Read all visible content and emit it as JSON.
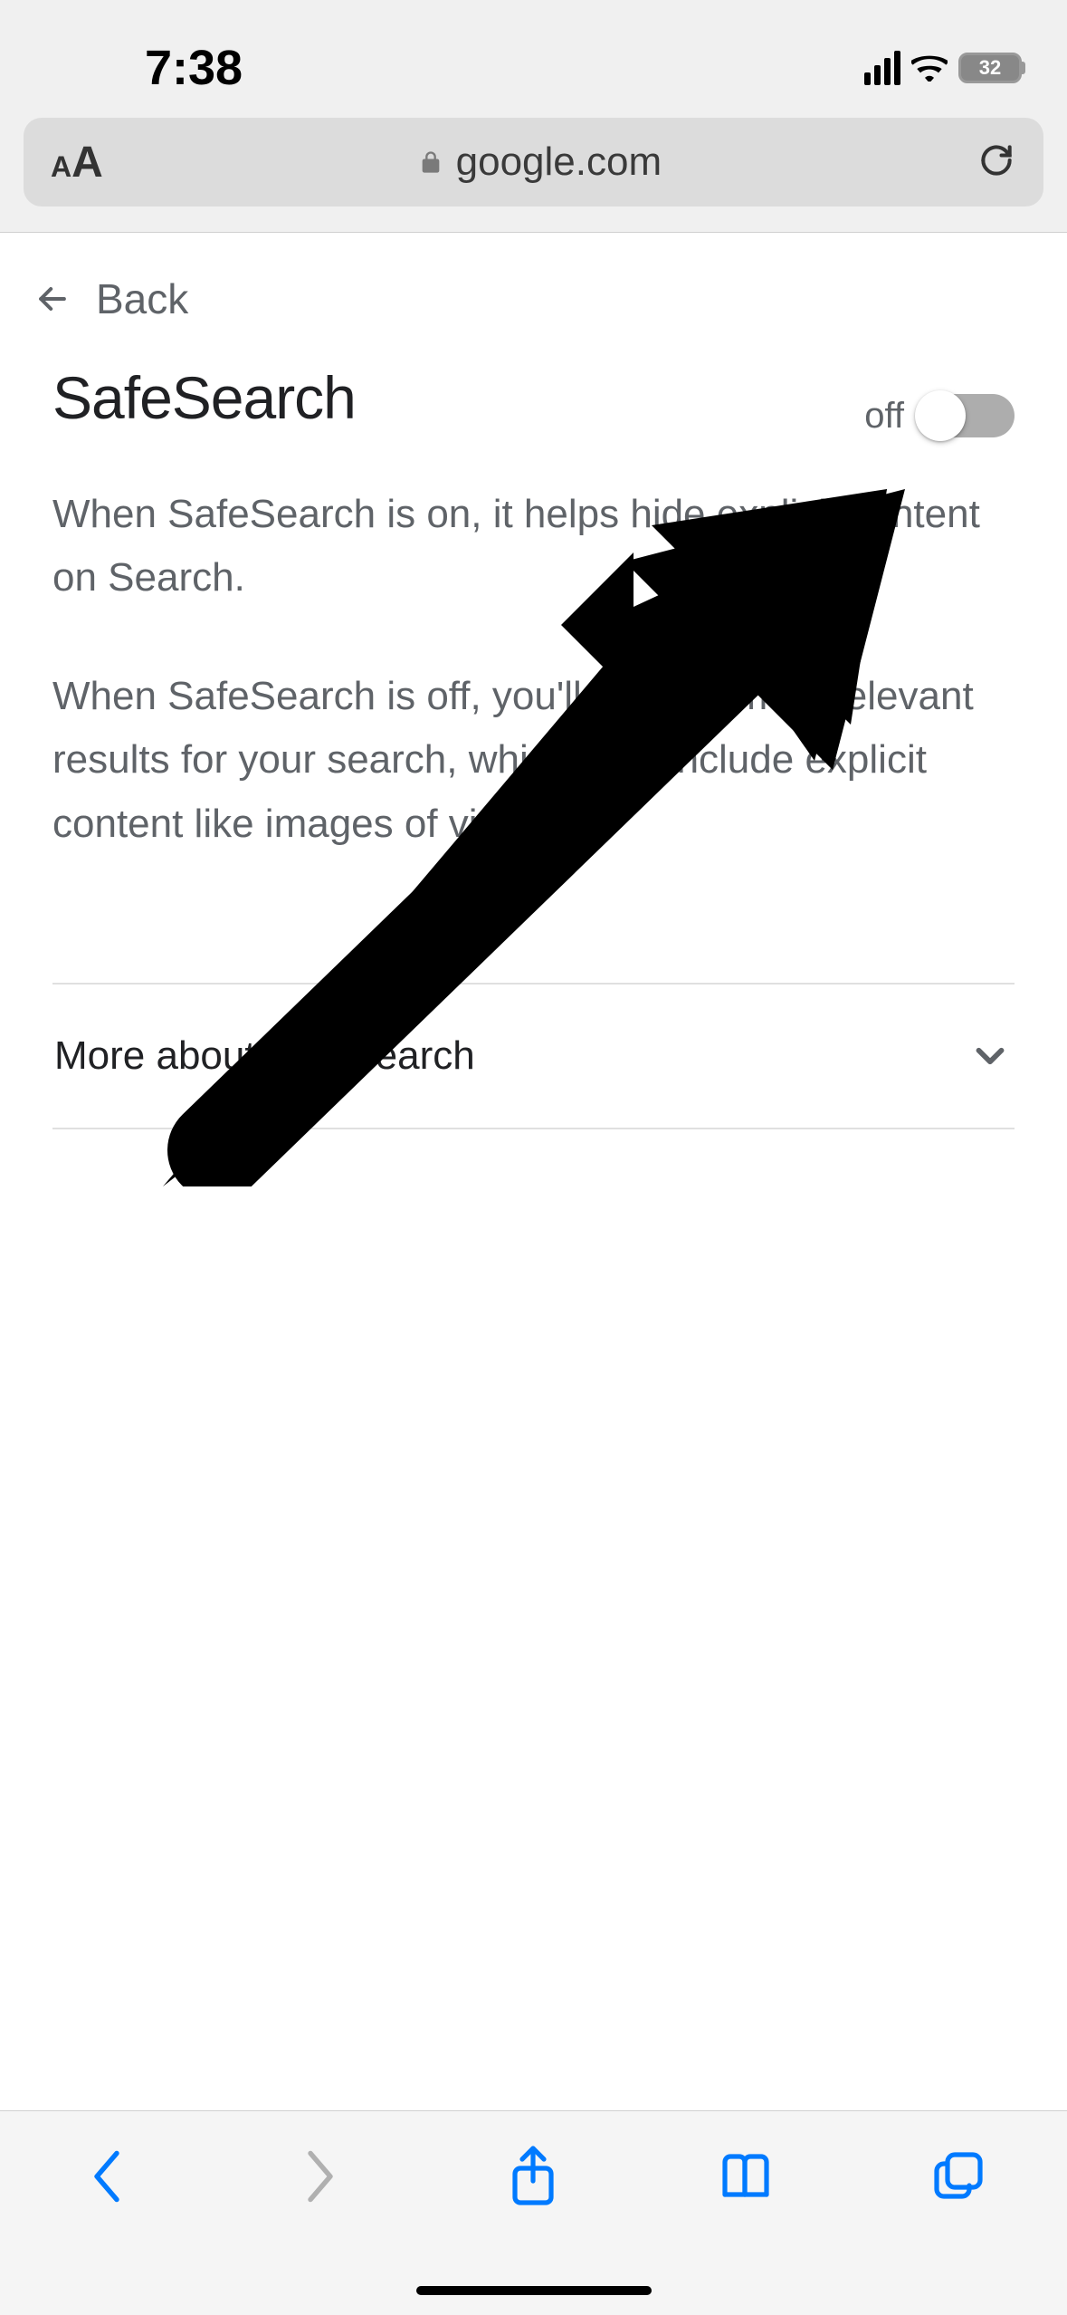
{
  "status_bar": {
    "time": "7:38",
    "battery_percent": "32"
  },
  "browser": {
    "url": "google.com"
  },
  "nav": {
    "back_label": "Back"
  },
  "settings": {
    "title": "SafeSearch",
    "toggle_state": "off",
    "paragraph1": "When SafeSearch is on, it helps hide explicit content on Search.",
    "paragraph2": "When SafeSearch is off, you'll see the most relevant results for your search, which may include explicit content like images of violence.",
    "more_label": "More about SafeSearch"
  }
}
